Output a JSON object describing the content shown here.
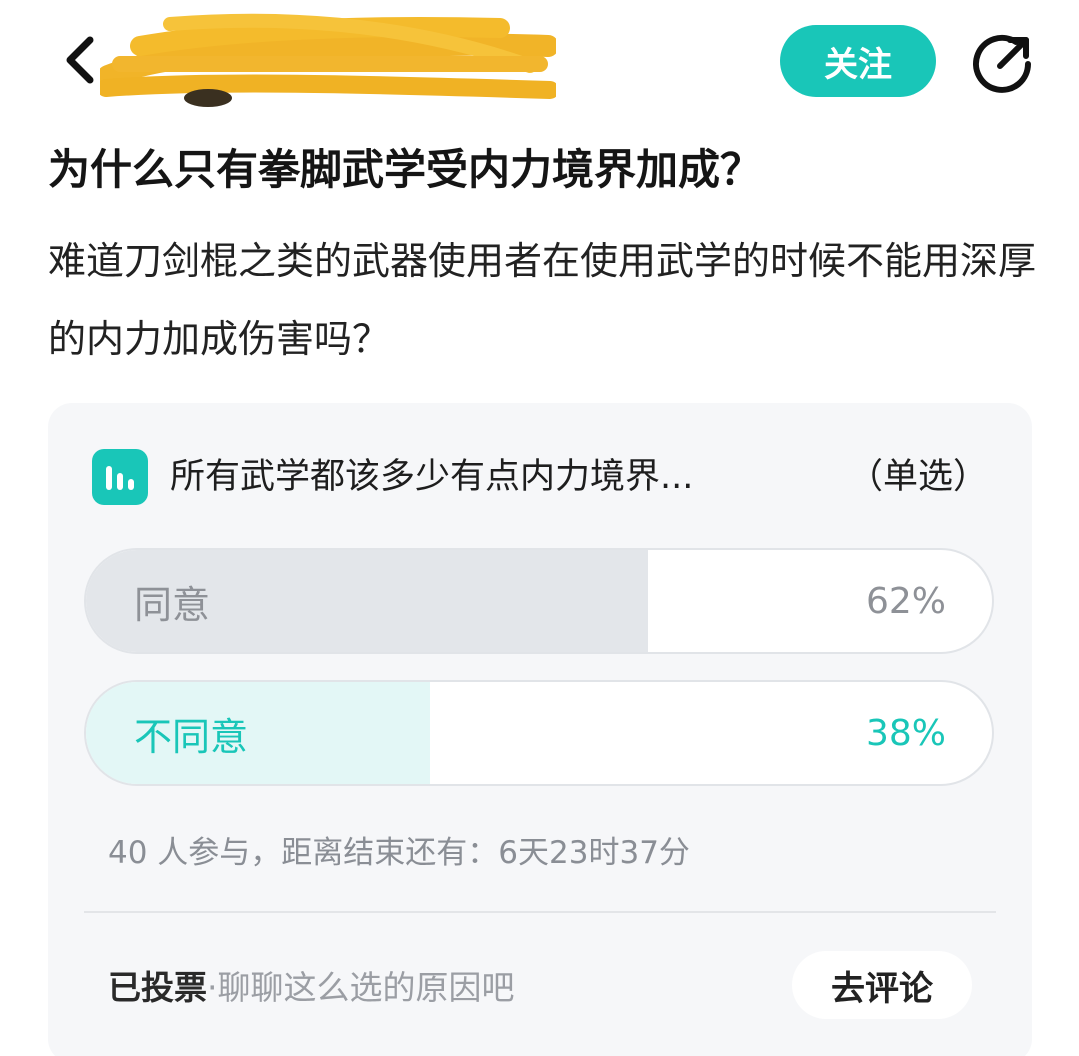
{
  "header": {
    "follow_label": "关注"
  },
  "question": {
    "title": "为什么只有拳脚武学受内力境界加成？",
    "description": "难道刀剑棍之类的武器使用者在使用武学的时候不能用深厚的内力加成伤害吗？"
  },
  "poll": {
    "question": "所有武学都该多少有点内力境界...",
    "type_label": "（单选）",
    "options": [
      {
        "label": "同意",
        "percent_text": "62%",
        "percent": 62,
        "selected": false
      },
      {
        "label": "不同意",
        "percent_text": "38%",
        "percent": 38,
        "selected": true
      }
    ],
    "meta": "40 人参与，距离结束还有：6天23时37分",
    "voted_label": "已投票",
    "voted_sep": "·",
    "voted_hint": "聊聊这么选的原因吧",
    "comment_button": "去评论"
  },
  "colors": {
    "accent": "#19c6b8",
    "selected_fill": "#e3f7f6",
    "unselected_fill": "#e3e6ea",
    "unselected_text": "#8e9197",
    "author_redaction": "#f1b428"
  }
}
